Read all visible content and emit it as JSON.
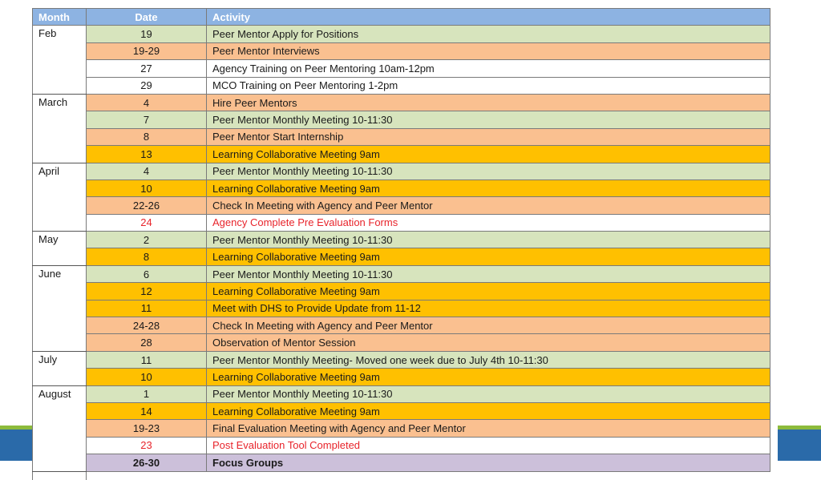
{
  "header": {
    "month": "Month",
    "date": "Date",
    "activity": "Activity"
  },
  "groups": [
    {
      "month": "Feb",
      "rows": [
        {
          "date": "19",
          "activity": "Peer Mentor Apply for Positions",
          "style": "green"
        },
        {
          "date": "19-29",
          "activity": "Peer Mentor Interviews",
          "style": "salmon"
        },
        {
          "date": "27",
          "activity": "Agency Training on Peer Mentoring 10am-12pm",
          "style": "white"
        },
        {
          "date": "29",
          "activity": "MCO Training on Peer Mentoring 1-2pm",
          "style": "white"
        }
      ]
    },
    {
      "month": "March",
      "rows": [
        {
          "date": "4",
          "activity": "Hire Peer Mentors",
          "style": "salmon"
        },
        {
          "date": "7",
          "activity": "Peer Mentor Monthly Meeting 10-11:30",
          "style": "green"
        },
        {
          "date": "8",
          "activity": "Peer Mentor Start Internship",
          "style": "salmon"
        },
        {
          "date": "13",
          "activity": "Learning Collaborative Meeting 9am",
          "style": "gold"
        }
      ]
    },
    {
      "month": "April",
      "rows": [
        {
          "date": "4",
          "activity": "Peer Mentor Monthly Meeting 10-11:30",
          "style": "green"
        },
        {
          "date": "10",
          "activity": "Learning Collaborative Meeting 9am",
          "style": "gold"
        },
        {
          "date": "22-26",
          "activity": "Check In Meeting with Agency and Peer Mentor",
          "style": "salmon"
        },
        {
          "date": "24",
          "activity": "Agency Complete Pre Evaluation Forms",
          "style": "white red"
        }
      ]
    },
    {
      "month": "May",
      "rows": [
        {
          "date": "2",
          "activity": "Peer Mentor Monthly Meeting 10-11:30",
          "style": "green"
        },
        {
          "date": "8",
          "activity": "Learning Collaborative Meeting 9am",
          "style": "gold"
        }
      ]
    },
    {
      "month": "June",
      "rows": [
        {
          "date": "6",
          "activity": "Peer Mentor Monthly Meeting 10-11:30",
          "style": "green"
        },
        {
          "date": "12",
          "activity": "Learning Collaborative Meeting 9am",
          "style": "gold"
        },
        {
          "date": "11",
          "activity": "Meet with DHS to Provide Update from 11-12",
          "style": "gold"
        },
        {
          "date": "24-28",
          "activity": "Check In Meeting with Agency and Peer Mentor",
          "style": "salmon"
        },
        {
          "date": "28",
          "activity": "Observation of Mentor Session",
          "style": "salmon"
        }
      ]
    },
    {
      "month": "July",
      "rows": [
        {
          "date": "11",
          "activity": "Peer Mentor Monthly Meeting- Moved one week due to July 4th  10-11:30",
          "style": "green"
        },
        {
          "date": "10",
          "activity": "Learning Collaborative Meeting 9am",
          "style": "gold"
        }
      ]
    },
    {
      "month": "August",
      "rows": [
        {
          "date": "1",
          "activity": "Peer Mentor Monthly Meeting 10-11:30",
          "style": "green"
        },
        {
          "date": "14",
          "activity": "Learning Collaborative Meeting 9am",
          "style": "gold"
        },
        {
          "date": "19-23",
          "activity": "Final Evaluation Meeting with Agency and Peer Mentor",
          "style": "salmon"
        },
        {
          "date": "23",
          "activity": "Post Evaluation Tool Completed",
          "style": "white red"
        },
        {
          "date": "26-30",
          "activity": "Focus Groups",
          "style": "purple"
        }
      ]
    }
  ],
  "colors": {
    "header": "#8db3e2",
    "green": "#d7e4bd",
    "salmon": "#fac090",
    "gold": "#ffc000",
    "purple": "#ccc0da",
    "red_text": "#e8242b",
    "band_blue": "#2a6aa9",
    "band_green": "#8dbb3c"
  }
}
